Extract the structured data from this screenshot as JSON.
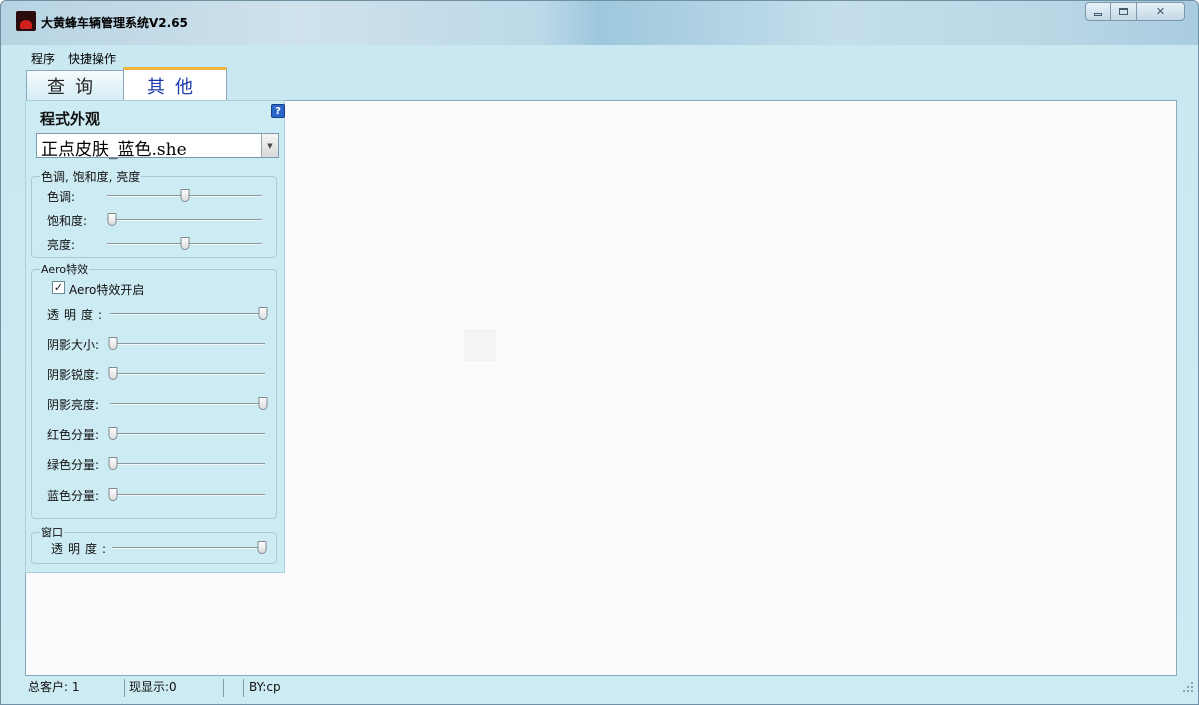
{
  "window": {
    "title": "大黄蜂车辆管理系统V2.65"
  },
  "menu": [
    "程序",
    "快捷操作"
  ],
  "tabs": {
    "query": "查询",
    "other": "其他",
    "active": "其他"
  },
  "appearance": {
    "group_title": "程式外观",
    "skin_selected": "正点皮肤_蓝色.she",
    "hsl": {
      "title": "色调, 饱和度, 亮度",
      "hue": {
        "label": "色调:",
        "value": 0.5
      },
      "saturation": {
        "label": "饱和度:",
        "value": 0.0
      },
      "brightness": {
        "label": "亮度:",
        "value": 0.5
      }
    },
    "aero": {
      "title": "Aero特效",
      "enable_label": "Aero特效开启",
      "enabled": true,
      "transparency": {
        "label": "透明度:",
        "value": 1.0
      },
      "shadow_size": {
        "label": "阴影大小:",
        "value": 0.0
      },
      "shadow_sharpness": {
        "label": "阴影锐度:",
        "value": 0.0
      },
      "shadow_brightness": {
        "label": "阴影亮度:",
        "value": 1.0
      },
      "red": {
        "label": "红色分量:",
        "value": 0.0
      },
      "green": {
        "label": "绿色分量:",
        "value": 0.0
      },
      "blue": {
        "label": "蓝色分量:",
        "value": 0.0
      }
    },
    "window_group": {
      "title": "窗口",
      "transparency": {
        "label": "透明度:",
        "value": 1.0
      }
    }
  },
  "statusbar": {
    "total_customers": "总客户: 1",
    "now_showing": "现显示:0",
    "author": "BY:cp"
  },
  "colors": {
    "panel_bg": "#cdebf3",
    "active_tab_text": "#1a38a8",
    "active_tab_accent": "#f4b63a"
  }
}
